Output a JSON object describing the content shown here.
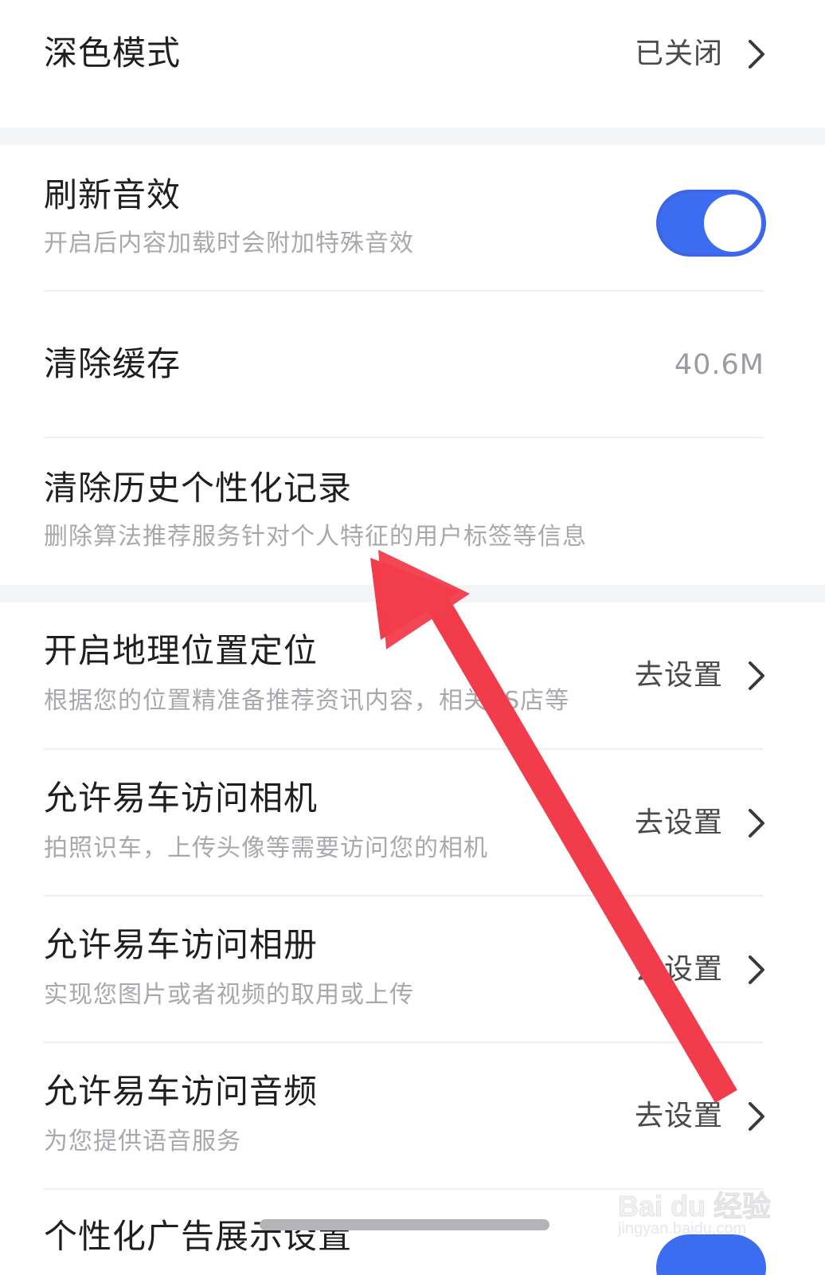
{
  "settings": {
    "dark_mode": {
      "title": "深色模式",
      "value": "已关闭"
    },
    "refresh_sound": {
      "title": "刷新音效",
      "subtitle": "开启后内容加载时会附加特殊音效",
      "enabled": true
    },
    "clear_cache": {
      "title": "清除缓存",
      "value": "40.6M"
    },
    "clear_history": {
      "title": "清除历史个性化记录",
      "subtitle": "删除算法推荐服务针对个人特征的用户标签等信息"
    },
    "location": {
      "title": "开启地理位置定位",
      "subtitle": "根据您的位置精准备推荐资讯内容，相关4S店等",
      "action": "去设置"
    },
    "camera": {
      "title": "允许易车访问相机",
      "subtitle": "拍照识车，上传头像等需要访问您的相机",
      "action": "去设置"
    },
    "photos": {
      "title": "允许易车访问相册",
      "subtitle": "实现您图片或者视频的取用或上传",
      "action": "去设置"
    },
    "audio": {
      "title": "允许易车访问音频",
      "subtitle": "为您提供语音服务",
      "action": "去设置"
    },
    "personalized_ads": {
      "title": "个性化广告展示设置"
    }
  },
  "watermark": {
    "logo": "Bai du 经验",
    "url": "jingyan.baidu.com"
  },
  "icons": {
    "chevron": "chevron-right-icon",
    "annotation": "red-arrow-annotation"
  },
  "colors": {
    "accent": "#3c6df0",
    "annotation": "#f23c4c",
    "divider": "#f0f0f2",
    "section_gap": "#f4f5f7",
    "subtitle": "#a9a9ad"
  }
}
